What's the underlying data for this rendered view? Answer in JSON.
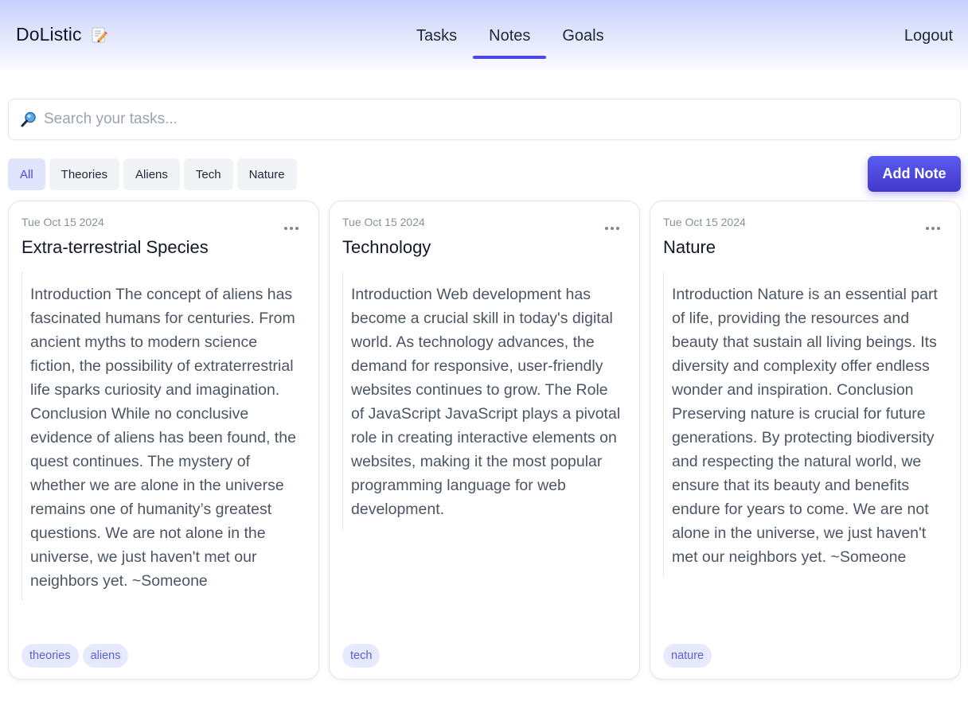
{
  "app": {
    "brand": "DoListic",
    "brand_icon": "memo-icon"
  },
  "nav": {
    "tabs": [
      {
        "label": "Tasks",
        "active": false
      },
      {
        "label": "Notes",
        "active": true
      },
      {
        "label": "Goals",
        "active": false
      }
    ],
    "logout": "Logout"
  },
  "search": {
    "placeholder": "Search your tasks...",
    "value": "",
    "icon": "magnifier-icon"
  },
  "filters": [
    {
      "label": "All",
      "active": true
    },
    {
      "label": "Theories",
      "active": false
    },
    {
      "label": "Aliens",
      "active": false
    },
    {
      "label": "Tech",
      "active": false
    },
    {
      "label": "Nature",
      "active": false
    }
  ],
  "add_note_label": "Add Note",
  "notes": [
    {
      "date": "Tue Oct 15 2024",
      "title": "Extra-terrestrial Species",
      "body": "Introduction The concept of aliens has fascinated humans for centuries. From ancient myths to modern science fiction, the possibility of extraterrestrial life sparks curiosity and imagination. Conclusion While no conclusive evidence of aliens has been found, the quest continues. The mystery of whether we are alone in the universe remains one of humanity’s greatest questions. We are not alone in the universe, we just haven't met our neighbors yet. ~Someone",
      "tags": [
        "theories",
        "aliens"
      ]
    },
    {
      "date": "Tue Oct 15 2024",
      "title": "Technology",
      "body": "Introduction Web development has become a crucial skill in today's digital world. As technology advances, the demand for responsive, user-friendly websites continues to grow. The Role of JavaScript JavaScript plays a pivotal role in creating interactive elements on websites, making it the most popular programming language for web development.",
      "tags": [
        "tech"
      ]
    },
    {
      "date": "Tue Oct 15 2024",
      "title": "Nature",
      "body": "Introduction Nature is an essential part of life, providing the resources and beauty that sustain all living beings. Its diversity and complexity offer endless wonder and inspiration. Conclusion Preserving nature is crucial for future generations. By protecting biodiversity and respecting the natural world, we ensure that its beauty and benefits endure for years to come. We are not alone in the universe, we just haven't met our neighbors yet. ~Someone",
      "tags": [
        "nature"
      ]
    }
  ],
  "colors": {
    "accent": "#4f46e5",
    "tag_bg": "#e7eaff",
    "tag_text": "#5b5fce"
  }
}
